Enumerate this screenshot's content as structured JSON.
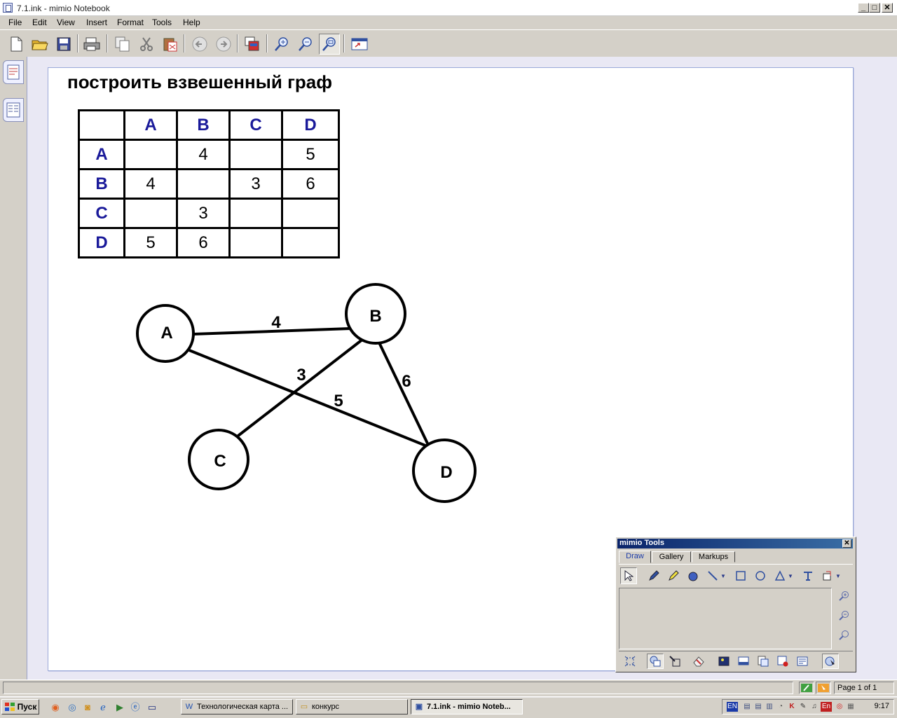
{
  "window": {
    "title": "7.1.ink - mimio Notebook",
    "minimize": "_",
    "maximize": "□",
    "close": "✕"
  },
  "menu": [
    "File",
    "Edit",
    "View",
    "Insert",
    "Format",
    "Tools",
    "Help"
  ],
  "toolbar_icons": [
    "new-document",
    "open-folder",
    "save",
    "print",
    "copy-page",
    "cut",
    "paste",
    "back",
    "forward",
    "screen-capture",
    "zoom-in",
    "zoom-out",
    "zoom-fit",
    "full-screen"
  ],
  "page": {
    "title": "построить взвешенный граф",
    "matrix": {
      "headers": [
        "A",
        "B",
        "C",
        "D"
      ],
      "rows": [
        {
          "label": "A",
          "cells": [
            "",
            "4",
            "",
            "5"
          ]
        },
        {
          "label": "B",
          "cells": [
            "4",
            "",
            "3",
            "6"
          ]
        },
        {
          "label": "C",
          "cells": [
            "",
            "3",
            "",
            ""
          ]
        },
        {
          "label": "D",
          "cells": [
            "5",
            "6",
            "",
            ""
          ]
        }
      ]
    },
    "graph": {
      "nodes": [
        "A",
        "B",
        "C",
        "D"
      ],
      "edges": [
        {
          "from": "A",
          "to": "B",
          "weight": "4"
        },
        {
          "from": "B",
          "to": "C",
          "weight": "3"
        },
        {
          "from": "A",
          "to": "D",
          "weight": "5"
        },
        {
          "from": "B",
          "to": "D",
          "weight": "6"
        }
      ]
    }
  },
  "mimio_tools": {
    "title": "mimio Tools",
    "tabs": [
      "Draw",
      "Gallery",
      "Markups"
    ],
    "active_tab": "Draw"
  },
  "status": {
    "page_info": "Page 1 of 1"
  },
  "taskbar": {
    "start": "Пуск",
    "tasks": [
      {
        "label": "Технологическая карта ...",
        "active": false
      },
      {
        "label": "конкурс",
        "active": false
      },
      {
        "label": "7.1.ink - mimio Noteb...",
        "active": true
      }
    ],
    "language": "EN",
    "clock": "9:17"
  },
  "colors": {
    "header_blue": "#1a1a9a",
    "titlebar_blue": "#0a246a"
  }
}
